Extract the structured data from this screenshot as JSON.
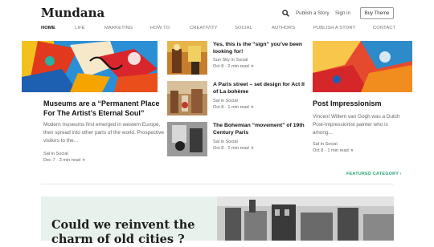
{
  "header": {
    "logo": "Mundana",
    "publish_label": "Publish a Story",
    "signin_label": "Sign in",
    "buy_label": "Buy Theme"
  },
  "nav": [
    "HOME",
    "LIFE",
    "MARKETING",
    "HOW TO",
    "CREATIVITY",
    "SOCIAL",
    "AUTHORS",
    "PUBLISH A STORY",
    "CONTACT"
  ],
  "left_card": {
    "title": "Museums are a “Permanent Place For The Artist’s Eternal Soul”",
    "excerpt": "Modern museums first emerged in western Europe, then spread into other parts of the world. Prospective visitors to the...",
    "author_line": "Sal in Social",
    "date_line": "Dec 7 · 3 min read",
    "star": "★"
  },
  "mid_list": [
    {
      "title": "Yes, this is the “sign” you’ve been looking for!",
      "author_line": "Sun Sky in Social",
      "date_line": "Oct 8 · 2 min read",
      "star": "★"
    },
    {
      "title": "A Paris street – set design for Act II of La bohème",
      "author_line": "Sal in Social",
      "date_line": "Oct 8 · 1 min read",
      "star": "★"
    },
    {
      "title": "The Bohemian “movement” of 19th Century Paris",
      "author_line": "Sal in Social",
      "date_line": "Oct 8 · 2 min read",
      "star": "★"
    }
  ],
  "right_card": {
    "title": "Post Impressionism",
    "excerpt": "Vincent Willem van Gogh was a Dutch Post-Impressionist painter who is among...",
    "author_line": "Sal in Social",
    "date_line": "Oct 8 · 1 min read",
    "star": "★"
  },
  "featured_link": "FEATURED CATEGORY ›",
  "promo": {
    "title": "Could we reinvent the charm of old cities ?"
  },
  "colors": {
    "accent": "#2aa876",
    "promo_bg": "#e8f2ec"
  }
}
